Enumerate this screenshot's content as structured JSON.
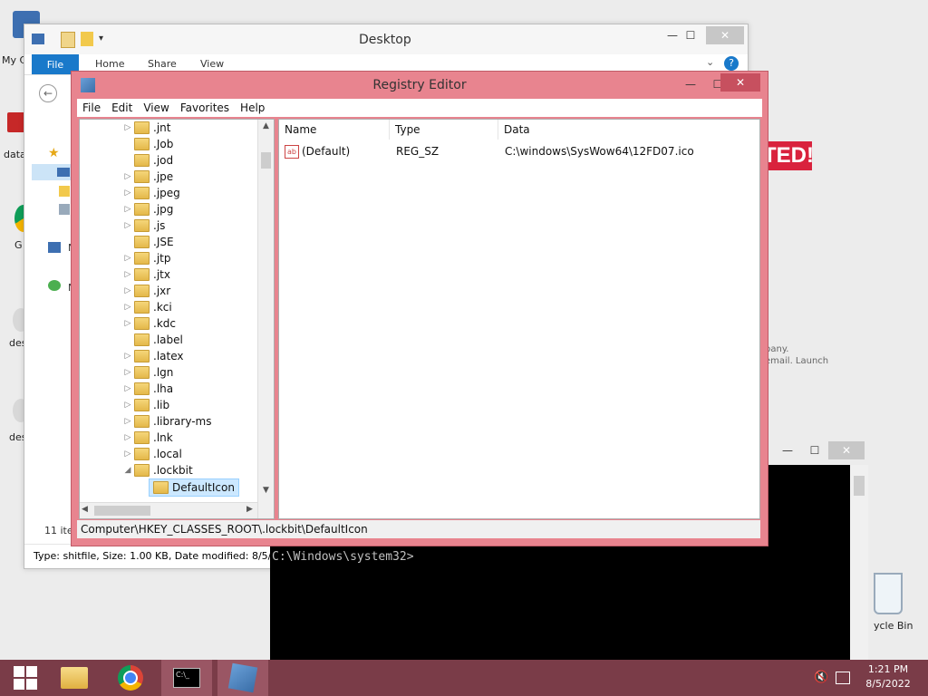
{
  "desktop": {
    "icons": [
      {
        "label": "My C"
      },
      {
        "label": "data"
      },
      {
        "label": "G"
      },
      {
        "label": "des"
      },
      {
        "label": "des"
      },
      {
        "label": "ycle Bin"
      }
    ],
    "ransom_text": "TED!",
    "background_text_1": "pany.",
    "background_text_2": "email. Launch"
  },
  "explorer": {
    "title": "Desktop",
    "tabs": [
      "File",
      "Home",
      "Share",
      "View"
    ],
    "item_count": "11 ite",
    "nav_letters": [
      "F",
      "N",
      "N"
    ],
    "status": "Type: shitfile, Size: 1.00 KB, Date modified: 8/5/2"
  },
  "regedit": {
    "title": "Registry Editor",
    "menu": [
      "File",
      "Edit",
      "View",
      "Favorites",
      "Help"
    ],
    "tree": [
      {
        "label": ".jnt",
        "expander": true
      },
      {
        "label": ".Job",
        "expander": false
      },
      {
        "label": ".jod",
        "expander": false
      },
      {
        "label": ".jpe",
        "expander": true
      },
      {
        "label": ".jpeg",
        "expander": true
      },
      {
        "label": ".jpg",
        "expander": true
      },
      {
        "label": ".js",
        "expander": true
      },
      {
        "label": ".JSE",
        "expander": false
      },
      {
        "label": ".jtp",
        "expander": true
      },
      {
        "label": ".jtx",
        "expander": true
      },
      {
        "label": ".jxr",
        "expander": true
      },
      {
        "label": ".kci",
        "expander": true
      },
      {
        "label": ".kdc",
        "expander": true
      },
      {
        "label": ".label",
        "expander": false
      },
      {
        "label": ".latex",
        "expander": true
      },
      {
        "label": ".lgn",
        "expander": true
      },
      {
        "label": ".lha",
        "expander": true
      },
      {
        "label": ".lib",
        "expander": true
      },
      {
        "label": ".library-ms",
        "expander": true
      },
      {
        "label": ".lnk",
        "expander": true
      },
      {
        "label": ".local",
        "expander": true
      },
      {
        "label": ".lockbit",
        "expander": true,
        "expanded": true
      }
    ],
    "selected_key": "DefaultIcon",
    "columns": [
      "Name",
      "Type",
      "Data"
    ],
    "values": [
      {
        "name": "(Default)",
        "type": "REG_SZ",
        "data": "C:\\windows\\SysWow64\\12FD07.ico"
      }
    ],
    "status_path": "Computer\\HKEY_CLASSES_ROOT\\.lockbit\\DefaultIcon"
  },
  "console": {
    "prompt": "C:\\Windows\\system32>"
  },
  "taskbar": {
    "clock_time": "1:21 PM",
    "clock_date": "8/5/2022"
  },
  "colors": {
    "regedit_frame": "#e8848f",
    "taskbar": "#7a3c48",
    "explorer_file_tab": "#1979ca"
  }
}
